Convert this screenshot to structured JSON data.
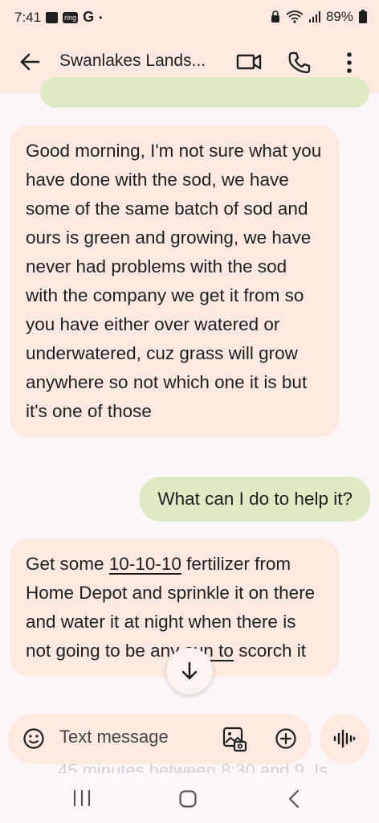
{
  "status_bar": {
    "time": "7:41",
    "ring_label": "ring",
    "g_label": "G",
    "dot": "•",
    "battery": "89%"
  },
  "app_bar": {
    "title": "Swanlakes Lands..."
  },
  "messages": [
    {
      "direction": "incoming",
      "text": "Good morning, I'm not sure what you have done with the sod, we have some of the same batch of sod and ours is green and growing, we have never had problems with the sod with the company we get it from so you have either over watered or underwatered, cuz grass will grow anywhere so not which one it is but it's one of those"
    },
    {
      "direction": "outgoing",
      "text": "What can I do to help it?"
    },
    {
      "direction": "incoming",
      "parts": [
        "Get some ",
        "10-10-10",
        " fertilizer from Home Depot and sprinkle it on there and water it at night when there is not going to be any ",
        "sun to",
        " scorch it"
      ]
    }
  ],
  "composer": {
    "placeholder": "Text message"
  },
  "faded_text": "45 minutes between 8:30 and 9. Is",
  "icons": {
    "back": "arrow-back-icon",
    "video": "video-call-icon",
    "phone": "phone-icon",
    "more": "more-vert-icon",
    "emoji": "emoji-icon",
    "gallery": "gallery-icon",
    "add": "add-icon",
    "voice": "voice-icon",
    "scroll_down": "arrow-down-icon"
  },
  "colors": {
    "incoming_bubble": "#fde9df",
    "outgoing_bubble": "#dcebc3",
    "app_bar": "#fde9df"
  }
}
